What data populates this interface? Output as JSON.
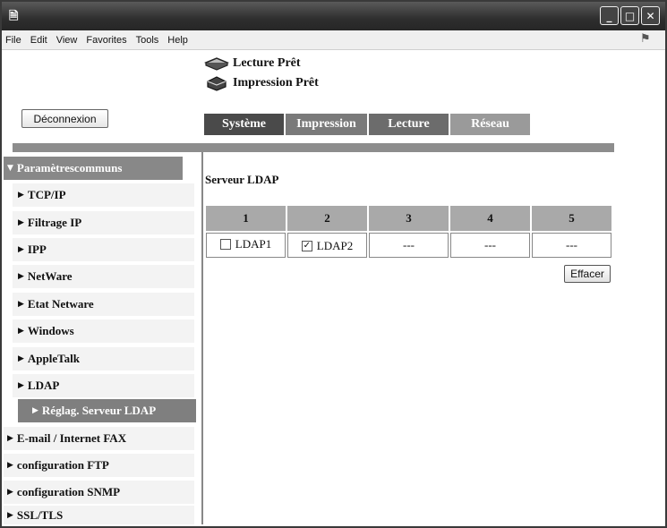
{
  "window": {
    "app_icon": "ie-page-icon",
    "controls": [
      "minimize",
      "maximize",
      "close"
    ]
  },
  "menubar": {
    "items": [
      "File",
      "Edit",
      "View",
      "Favorites",
      "Tools",
      "Help"
    ]
  },
  "status": {
    "scanner": "Lecture Prêt",
    "printer": "Impression Prêt"
  },
  "logout_label": "Déconnexion",
  "tabs": [
    "Système",
    "Impression",
    "Lecture",
    "Réseau"
  ],
  "sidebar": {
    "header": "Paramètrescommuns",
    "items": [
      "TCP/IP",
      "Filtrage IP",
      "IPP",
      "NetWare",
      "Etat Netware",
      "Windows",
      "AppleTalk",
      "LDAP"
    ],
    "selected": "Réglag. Serveur LDAP",
    "top_items": [
      "E-mail / Internet FAX",
      "configuration FTP",
      "configuration SNMP",
      "SSL/TLS"
    ]
  },
  "main": {
    "title": "Serveur LDAP",
    "columns": [
      "1",
      "2",
      "3",
      "4",
      "5"
    ],
    "cells": [
      {
        "label": "LDAP1",
        "checked": false
      },
      {
        "label": "LDAP2",
        "checked": true
      },
      {
        "label": "---"
      },
      {
        "label": "---"
      },
      {
        "label": "---"
      }
    ],
    "clear_label": "Effacer"
  }
}
